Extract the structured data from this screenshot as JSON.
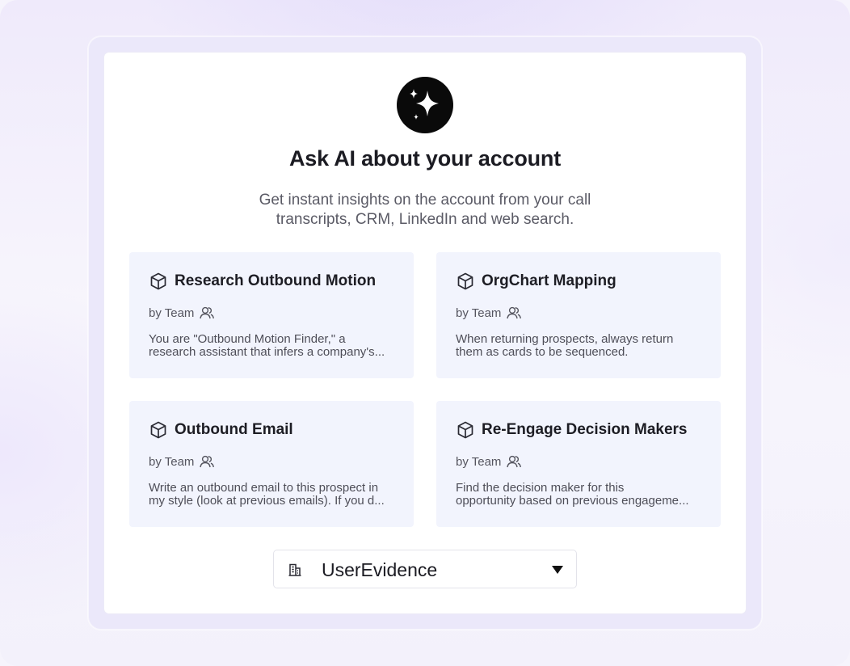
{
  "header": {
    "logo_icon": "sparkles-icon",
    "title": "Ask AI about your account",
    "subtitle_line1": "Get instant insights on the account from your call",
    "subtitle_line2": "transcripts, CRM, LinkedIn and web search."
  },
  "cards": [
    {
      "icon": "cube-icon",
      "name": "Research Outbound Motion",
      "by": "by Team",
      "by_icon": "team-icon",
      "desc_line1": "You are \"Outbound Motion Finder,\" a",
      "desc_line2": "research assistant that infers a company's..."
    },
    {
      "icon": "cube-icon",
      "name": "OrgChart Mapping",
      "by": "by Team",
      "by_icon": "team-icon",
      "desc_line1": "When returning prospects, always return",
      "desc_line2": "them as cards to be sequenced."
    },
    {
      "icon": "cube-icon",
      "name": "Outbound Email",
      "by": "by Team",
      "by_icon": "team-icon",
      "desc_line1": "Write an outbound email to this prospect in",
      "desc_line2": "my style (look at previous emails). If you d..."
    },
    {
      "icon": "cube-icon",
      "name": "Re-Engage Decision Makers",
      "by": "by Team",
      "by_icon": "team-icon",
      "desc_line1": "Find the decision maker for this",
      "desc_line2": "opportunity based on previous engageme..."
    }
  ],
  "account_select": {
    "icon": "building-icon",
    "value": "UserEvidence",
    "caret_icon": "caret-down-icon"
  },
  "colors": {
    "card_bg": "#f2f4fd",
    "frame_bg": "#ebe8fa",
    "text_dark": "#1b1b22"
  }
}
